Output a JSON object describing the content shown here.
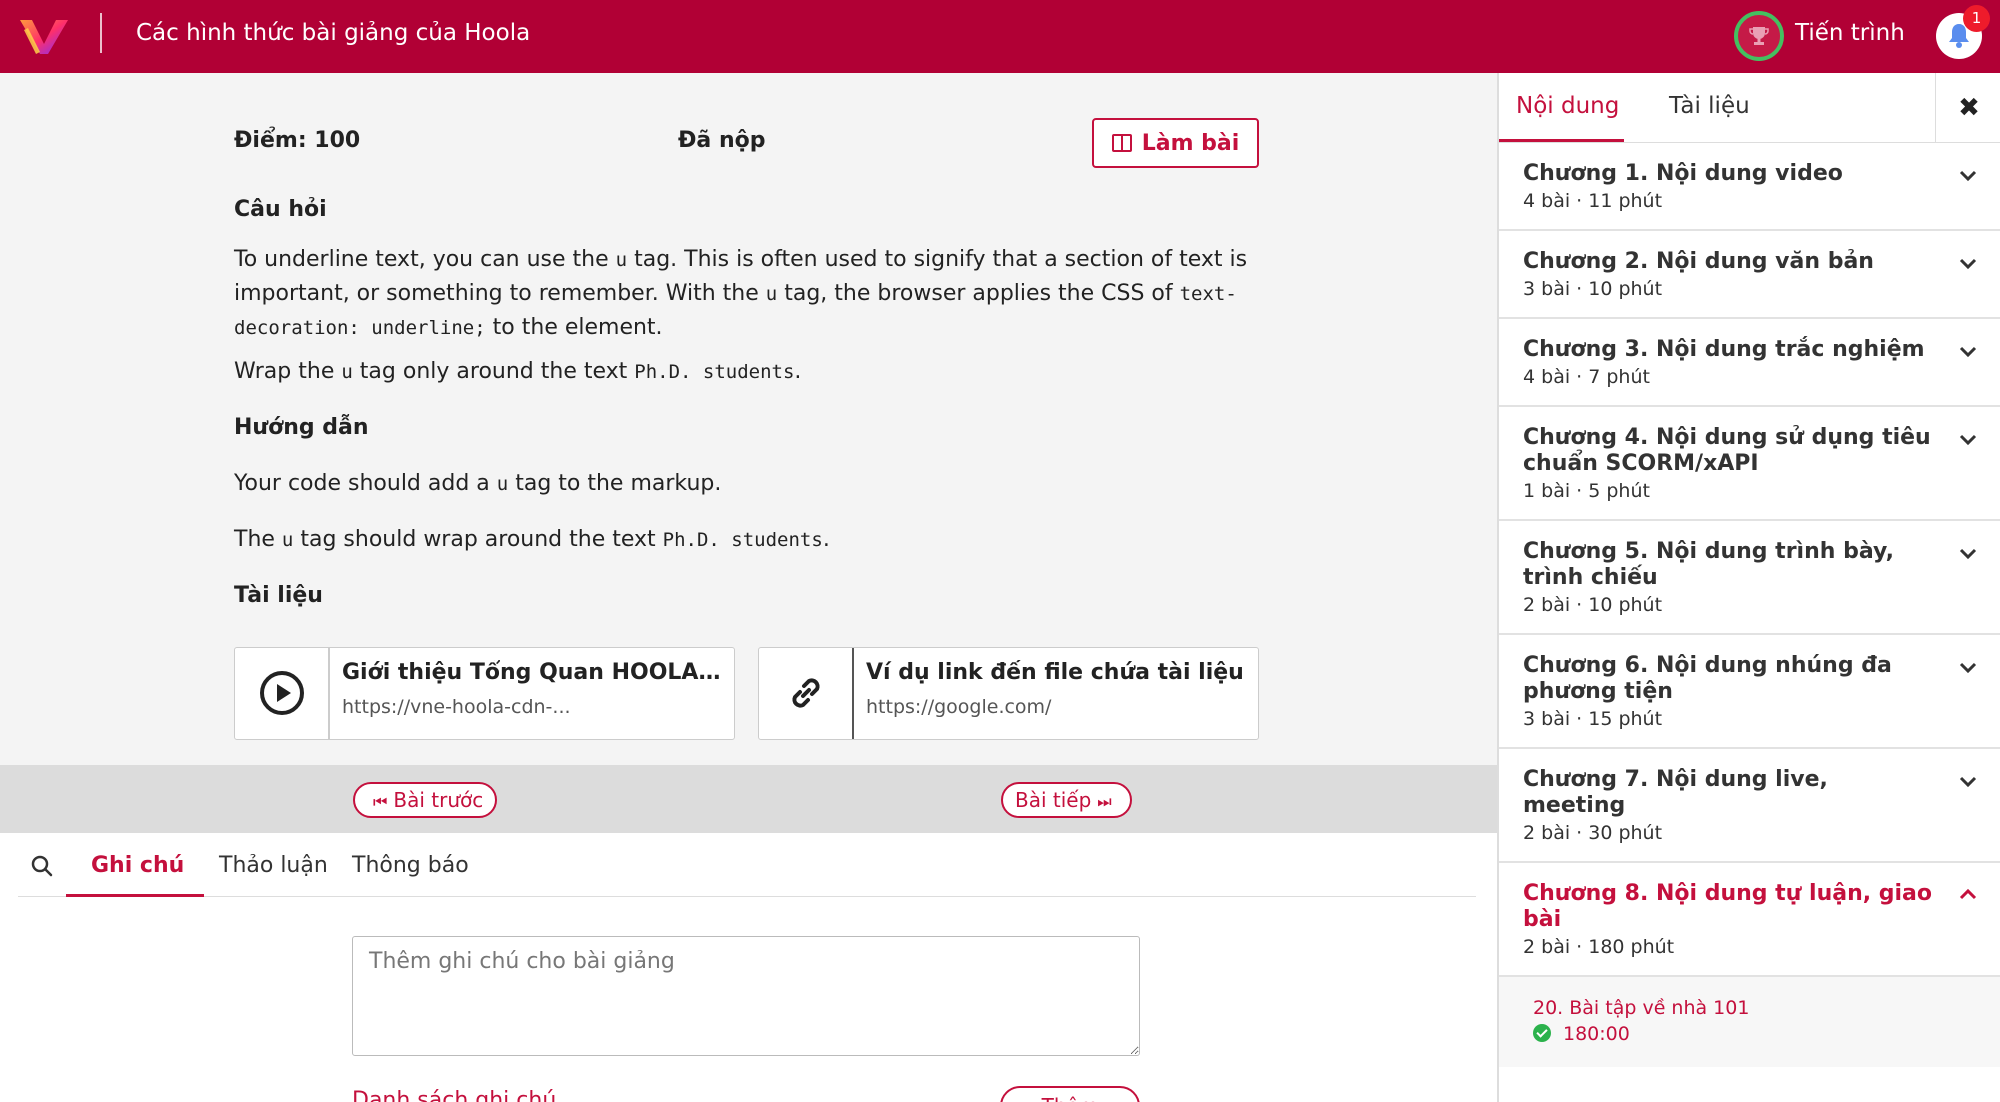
{
  "header": {
    "course_title": "Các hình thức bài giảng của Hoola",
    "progress_label": "Tiến trình",
    "notification_count": "1"
  },
  "summary": {
    "score": "Điểm: 100",
    "status": "Đã nộp",
    "do_button": "Làm bài"
  },
  "question": {
    "heading": "Câu hỏi",
    "p1_a": "To underline text, you can use the ",
    "p1_code1": "u",
    "p1_b": " tag. This is often used to signify that a section of text is important, or something to remember. With the ",
    "p1_code2": "u",
    "p1_c": " tag, the browser applies the CSS of ",
    "p1_code3": "text-decoration: underline;",
    "p1_d": " to the element.",
    "p2_a": "Wrap the ",
    "p2_code1": "u",
    "p2_b": " tag only around the text ",
    "p2_code2": "Ph.D. students",
    "p2_c": "."
  },
  "guide": {
    "heading": "Hướng dẫn",
    "p1_a": "Your code should add a ",
    "p1_code": "u",
    "p1_b": " tag to the markup.",
    "p2_a": "The ",
    "p2_code1": "u",
    "p2_b": " tag should wrap around the text ",
    "p2_code2": "Ph.D. students",
    "p2_c": "."
  },
  "documents": {
    "heading": "Tài liệu",
    "items": [
      {
        "name": "Giới thiệu Tổng Quan HOOLA -...",
        "url": "https://vne-hoola-cdn-...",
        "icon": "play-circle-icon"
      },
      {
        "name": "Ví dụ link đến file chứa tài liệu",
        "url": "https://google.com/",
        "icon": "link-icon"
      }
    ]
  },
  "nav": {
    "prev": "Bài trước",
    "next": "Bài tiếp"
  },
  "lower_tabs": {
    "notes": "Ghi chú",
    "discussion": "Thảo luận",
    "announcements": "Thông báo"
  },
  "notes": {
    "placeholder": "Thêm ghi chú cho bài giảng",
    "list_link": "Danh sách ghi chú",
    "add_button": "Thêm"
  },
  "sidebar": {
    "tab_content": "Nội dung",
    "tab_docs": "Tài liệu",
    "close": "✖",
    "chapters": [
      {
        "title": "Chương 1. Nội dung video",
        "meta": "4 bài · 11 phút"
      },
      {
        "title": "Chương 2. Nội dung văn bản",
        "meta": "3 bài · 10 phút"
      },
      {
        "title": "Chương 3. Nội dung trắc nghiệm",
        "meta": "4 bài · 7 phút"
      },
      {
        "title": "Chương 4. Nội dung sử dụng tiêu chuẩn SCORM/xAPI",
        "meta": "1 bài · 5 phút"
      },
      {
        "title": "Chương 5. Nội dung trình bày, trình chiếu",
        "meta": "2 bài · 10 phút"
      },
      {
        "title": "Chương 6. Nội dung nhúng đa phương tiện",
        "meta": "3 bài · 15 phút"
      },
      {
        "title": "Chương 7. Nội dung live, meeting",
        "meta": "2 bài · 30 phút"
      },
      {
        "title": "Chương 8. Nội dung tự luận, giao bài",
        "meta": "2 bài · 180 phút"
      }
    ],
    "active_lesson": {
      "title": "20. Bài tập về nhà 101",
      "time": "180:00"
    }
  },
  "colors": {
    "brand": "#b10035",
    "accent": "#c4103d",
    "success": "#2bb24c"
  }
}
